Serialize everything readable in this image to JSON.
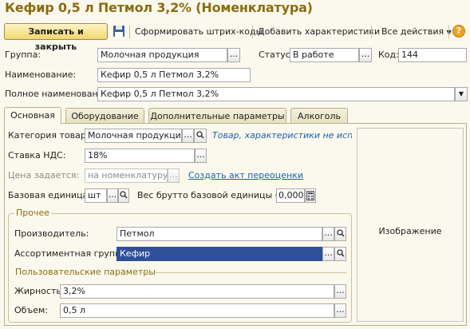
{
  "window": {
    "title": "Кефир 0,5 л  Петмол 3,2% (Номенклатура)"
  },
  "toolbar": {
    "save_close": "Записать и закрыть",
    "barcodes": "Сформировать штрих-коды",
    "add_chars": "Добавить характеристики",
    "all_actions": "Все действия",
    "help": "?"
  },
  "header": {
    "group_label": "Группа:",
    "group_value": "Молочная продукция",
    "status_label": "Статус:",
    "status_value": "В работе",
    "code_label": "Код:",
    "code_value": "144",
    "name_label": "Наименование:",
    "name_value": "Кефир 0,5 л  Петмол 3,2%",
    "full_name_label": "Полное наименование:",
    "full_name_value": "Кефир 0,5 л  Петмол 3,2%"
  },
  "tabs": [
    {
      "label": "Основная",
      "active": true
    },
    {
      "label": "Оборудование",
      "active": false
    },
    {
      "label": "Дополнительные параметры",
      "active": false
    },
    {
      "label": "Алкоголь",
      "active": false
    }
  ],
  "main": {
    "category_label": "Категория товара:",
    "category_value": "Молочная продукция",
    "category_hint": "Товар, характеристики не испол...",
    "vat_label": "Ставка НДС:",
    "vat_value": "18%",
    "price_label": "Цена задается:",
    "price_value": "на номенклатуру",
    "revaluation_link": "Создать акт переоценки",
    "unit_label": "Базовая единица:",
    "unit_value": "шт",
    "gross_label": "Вес брутто базовой единицы (кг):",
    "gross_value": "0,000",
    "other_group": "Прочее",
    "producer_label": "Производитель:",
    "producer_value": "Петмол",
    "assortment_label": "Ассортиментная группа:",
    "assortment_value": "Кефир",
    "user_params": "Пользовательские параметры",
    "fat_label": "Жирность:",
    "fat_value": "3,2%",
    "volume_label": "Объем:",
    "volume_value": "0,5 л",
    "image_label": "Изображение"
  },
  "colors": {
    "title": "#8a6d10",
    "background": "#fbf9ed",
    "selection": "#2f4f9a",
    "link": "#1a5fb4",
    "primary_button": "#f2d66e"
  },
  "icons": [
    "save-icon",
    "dropdown-arrow-icon",
    "help-icon",
    "ellipsis-icon",
    "search-icon",
    "calculator-icon"
  ]
}
